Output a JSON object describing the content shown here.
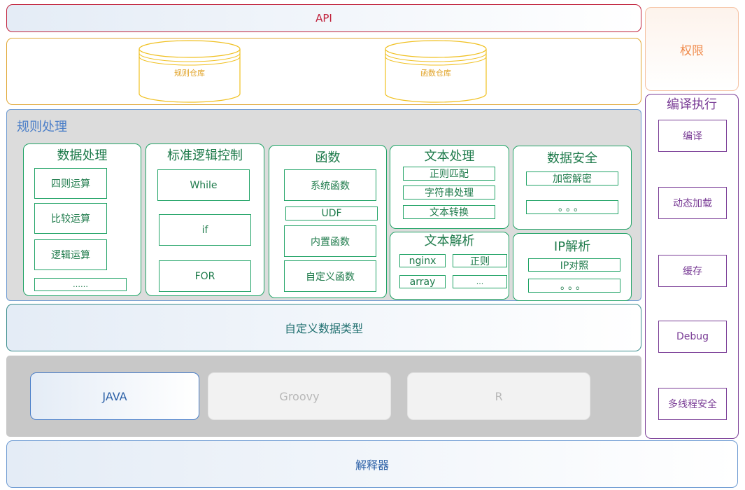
{
  "api": {
    "label": "API"
  },
  "repos": {
    "rule_repo": "规则仓库",
    "func_repo": "函数仓库"
  },
  "permissions": {
    "label": "权限"
  },
  "compile_exec": {
    "title": "编译执行",
    "items": [
      "编译",
      "动态加载",
      "缓存",
      "Debug",
      "多线程安全"
    ]
  },
  "rule_processing": {
    "title": "规则处理",
    "data_processing": {
      "title": "数据处理",
      "items": [
        "四则运算",
        "比较运算",
        "逻辑运算",
        "……"
      ]
    },
    "logic_control": {
      "title": "标准逻辑控制",
      "items": [
        "While",
        "if",
        "FOR"
      ]
    },
    "functions": {
      "title": "函数",
      "items": [
        "系统函数",
        "UDF",
        "内置函数",
        "自定义函数"
      ]
    },
    "text_processing": {
      "title": "文本处理",
      "items": [
        "正则匹配",
        "字符串处理",
        "文本转换"
      ]
    },
    "data_security": {
      "title": "数据安全",
      "items": [
        "加密解密",
        "。。。"
      ]
    },
    "text_parsing": {
      "title": "文本解析",
      "items": [
        "nginx",
        "正则",
        "array",
        "..."
      ]
    },
    "ip_parsing": {
      "title": "IP解析",
      "items": [
        "IP对照",
        "。。。"
      ]
    }
  },
  "custom_types": {
    "label": "自定义数据类型"
  },
  "languages": {
    "java": "JAVA",
    "groovy": "Groovy",
    "r": "R"
  },
  "interpreter": {
    "label": "解释器"
  },
  "colors": {
    "api": "#c0213b",
    "repo": "#e0a530",
    "permission": "#f08a4b",
    "exec": "#7a3d96",
    "rule": "#4a7ec8",
    "green": "#21a366",
    "teal": "#3a8c8c",
    "lang_bg": "#c8c8c8"
  }
}
